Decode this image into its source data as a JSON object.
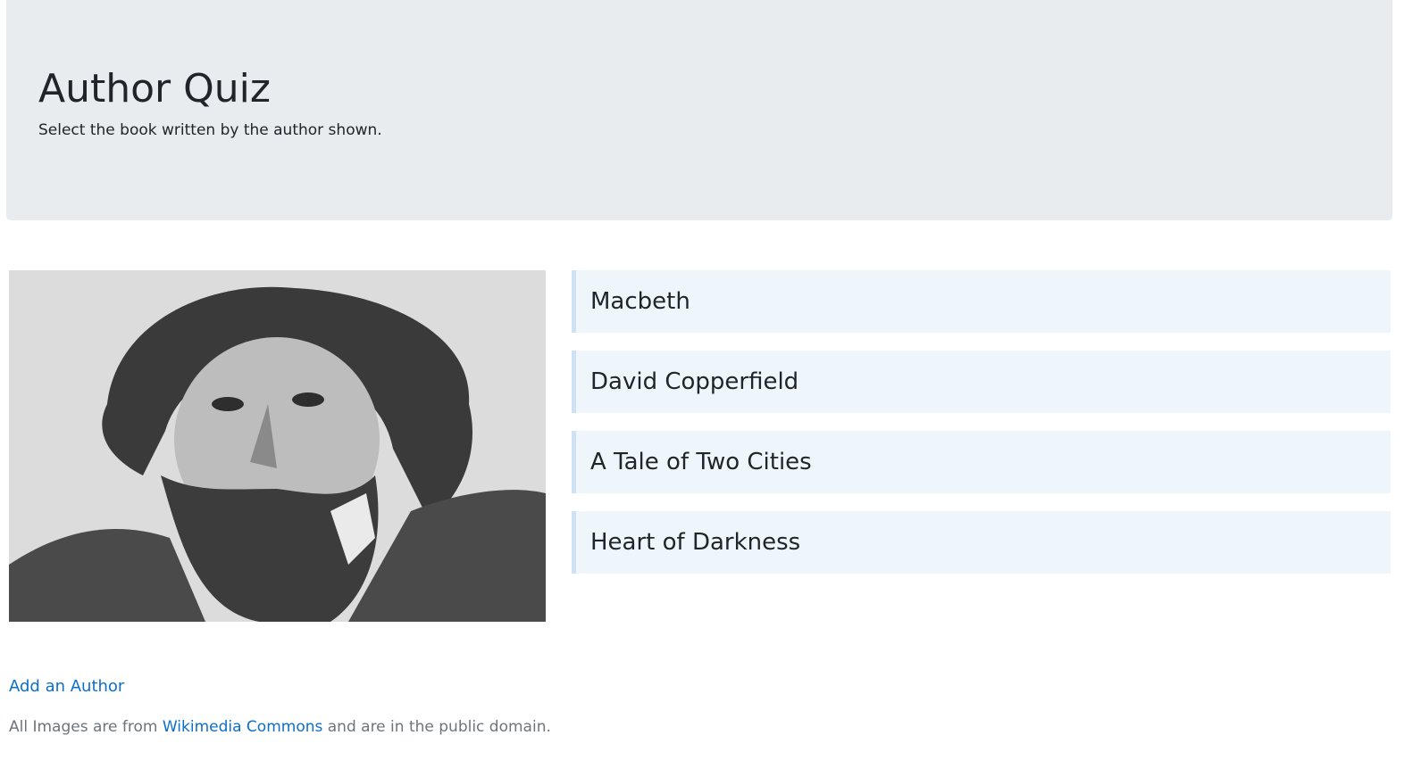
{
  "header": {
    "title": "Author Quiz",
    "subtitle": "Select the book written by the author shown."
  },
  "author": {
    "image_icon": "author-portrait-engraving"
  },
  "answers": [
    {
      "label": "Macbeth"
    },
    {
      "label": "David Copperfield"
    },
    {
      "label": "A Tale of Two Cities"
    },
    {
      "label": "Heart of Darkness"
    }
  ],
  "links": {
    "add_author": "Add an Author"
  },
  "footer": {
    "prefix": "All Images are from ",
    "link_text": "Wikimedia Commons",
    "suffix": " and are in the public domain."
  },
  "colors": {
    "jumbotron_bg": "#e9ecef",
    "answer_bg": "#eef6fc",
    "answer_border": "#cfe2f3",
    "link": "#0d6fc9",
    "muted_text": "#6c757d"
  }
}
